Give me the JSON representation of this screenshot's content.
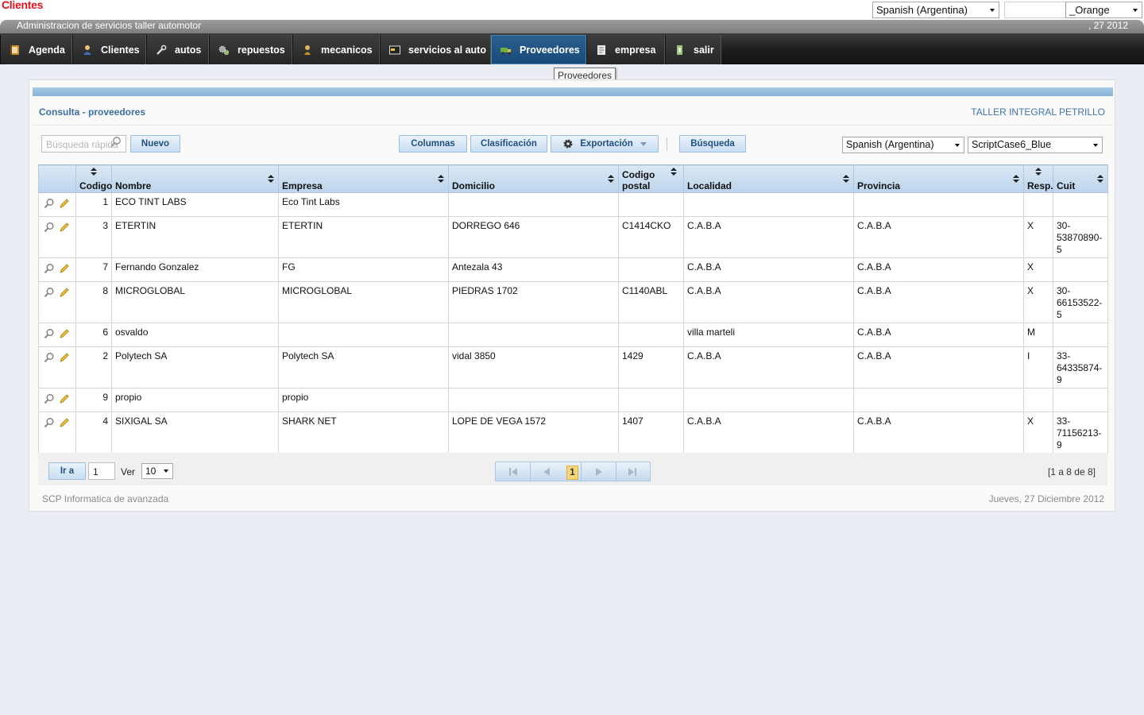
{
  "app": {
    "title": "Clientes",
    "subtitle": "Administracion de servicios taller automotor",
    "date_fragment": ", 27 2012"
  },
  "top_selects": {
    "language": "Spanish (Argentina)",
    "blank": "",
    "theme": "_Orange"
  },
  "menu": {
    "items": [
      {
        "label": "Agenda",
        "icon": "agenda-icon"
      },
      {
        "label": "Clientes",
        "icon": "person-icon"
      },
      {
        "label": "autos",
        "icon": "wrench-icon"
      },
      {
        "label": "repuestos",
        "icon": "gears-icon"
      },
      {
        "label": "mecanicos",
        "icon": "mechanic-icon"
      },
      {
        "label": "servicios al auto",
        "icon": "card-icon"
      },
      {
        "label": "Proveedores",
        "icon": "truck-icon",
        "active": true
      },
      {
        "label": "empresa",
        "icon": "document-icon"
      },
      {
        "label": "salir",
        "icon": "exit-icon"
      }
    ],
    "tooltip": "Proveedores"
  },
  "panel": {
    "title": "Consulta - proveedores",
    "company": "TALLER INTEGRAL PETRILLO"
  },
  "toolbar": {
    "quick_search_placeholder": "Búsqueda rápida",
    "nuevo": "Nuevo",
    "columnas": "Columnas",
    "clasificacion": "Clasificación",
    "exportacion": "Exportación",
    "busqueda": "Búsqueda",
    "language": "Spanish (Argentina)",
    "theme": "ScriptCase6_Blue"
  },
  "table": {
    "columns": [
      "Codigo",
      "Nombre",
      "Empresa",
      "Domicilio",
      "Codigo postal",
      "Localidad",
      "Provincia",
      "Resp.",
      "Cuit"
    ],
    "rows": [
      {
        "codigo": "1",
        "nombre": "ECO TINT LABS",
        "empresa": "Eco Tint Labs",
        "domicilio": "",
        "cp": "",
        "localidad": "",
        "provincia": "",
        "resp": "",
        "cuit": ""
      },
      {
        "codigo": "3",
        "nombre": "ETERTIN",
        "empresa": "ETERTIN",
        "domicilio": "DORREGO 646",
        "cp": "C1414CKO",
        "localidad": "C.A.B.A",
        "provincia": "C.A.B.A",
        "resp": "X",
        "cuit": "30-53870890-5"
      },
      {
        "codigo": "7",
        "nombre": "Fernando Gonzalez",
        "empresa": "FG",
        "domicilio": "Antezala 43",
        "cp": "",
        "localidad": "C.A.B.A",
        "provincia": "C.A.B.A",
        "resp": "X",
        "cuit": ""
      },
      {
        "codigo": "8",
        "nombre": "MICROGLOBAL",
        "empresa": "MICROGLOBAL",
        "domicilio": "PIEDRAS 1702",
        "cp": "C1140ABL",
        "localidad": "C.A.B.A",
        "provincia": "C.A.B.A",
        "resp": "X",
        "cuit": "30-66153522-5"
      },
      {
        "codigo": "6",
        "nombre": "osvaldo",
        "empresa": "",
        "domicilio": "",
        "cp": "",
        "localidad": "villa marteli",
        "provincia": "C.A.B.A",
        "resp": "M",
        "cuit": ""
      },
      {
        "codigo": "2",
        "nombre": "Polytech SA",
        "empresa": "Polytech SA",
        "domicilio": "vidal 3850",
        "cp": "1429",
        "localidad": "C.A.B.A",
        "provincia": "C.A.B.A",
        "resp": "I",
        "cuit": "33-64335874-9"
      },
      {
        "codigo": "9",
        "nombre": "propio",
        "empresa": "propio",
        "domicilio": "",
        "cp": "",
        "localidad": "",
        "provincia": "",
        "resp": "",
        "cuit": ""
      },
      {
        "codigo": "4",
        "nombre": "SIXIGAL SA",
        "empresa": "SHARK NET",
        "domicilio": "LOPE DE VEGA 1572",
        "cp": "1407",
        "localidad": "C.A.B.A",
        "provincia": "C.A.B.A",
        "resp": "X",
        "cuit": "33-71156213-9"
      }
    ]
  },
  "pager": {
    "ira": "Ir a",
    "page_input": "1",
    "ver": "Ver",
    "per_page": "10",
    "current_page": "1",
    "range": "[1 a 8 de 8]"
  },
  "footer": {
    "left": "SCP Informatica de avanzada",
    "right": "Jueves, 27 Diciembre 2012"
  },
  "colors": {
    "title_red": "#e0141e",
    "menu_active": "#1f5283",
    "header_link": "#3a6ea4",
    "page_highlight": "#f6d67a"
  }
}
